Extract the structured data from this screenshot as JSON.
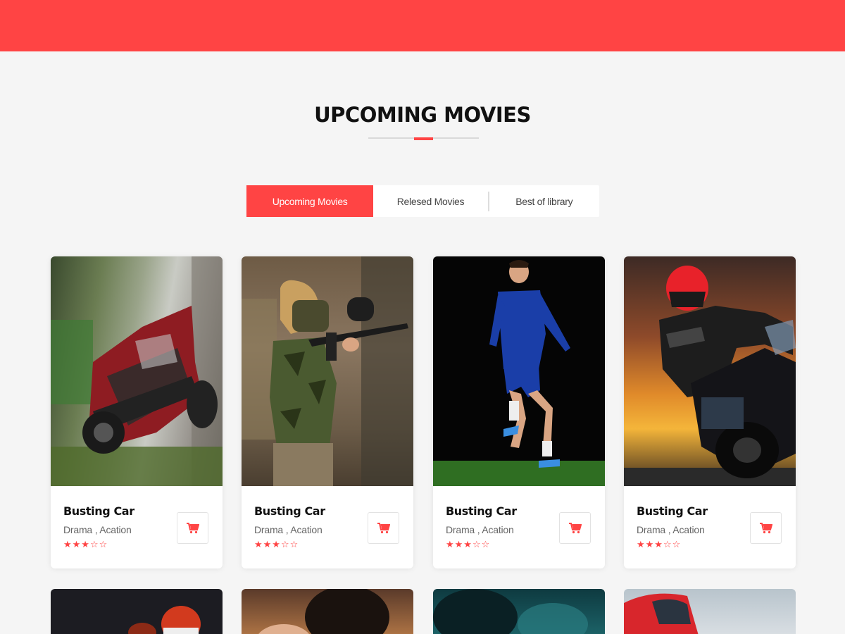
{
  "header": {
    "color": "#ff4444"
  },
  "section": {
    "title": "UPCOMING MOVIES"
  },
  "tabs": [
    {
      "label": "Upcoming Movies",
      "active": true
    },
    {
      "label": "Relesed Movies",
      "active": false
    },
    {
      "label": "Best of library",
      "active": false
    }
  ],
  "movies": [
    {
      "title": "Busting Car",
      "genre": "Drama , Acation",
      "rating": 3,
      "stars": "★★★☆☆",
      "poster": "crashed-car"
    },
    {
      "title": "Busting Car",
      "genre": "Drama , Acation",
      "rating": 3,
      "stars": "★★★☆☆",
      "poster": "paintball-girl"
    },
    {
      "title": "Busting Car",
      "genre": "Drama , Acation",
      "rating": 3,
      "stars": "★★★☆☆",
      "poster": "soccer-player"
    },
    {
      "title": "Busting Car",
      "genre": "Drama , Acation",
      "rating": 3,
      "stars": "★★★☆☆",
      "poster": "motorcycle-rider"
    }
  ],
  "next_row_posters": [
    "football-player",
    "couple",
    "storm-clouds",
    "red-car"
  ],
  "cart_icon": "cart-icon",
  "accent_color": "#ff4444"
}
